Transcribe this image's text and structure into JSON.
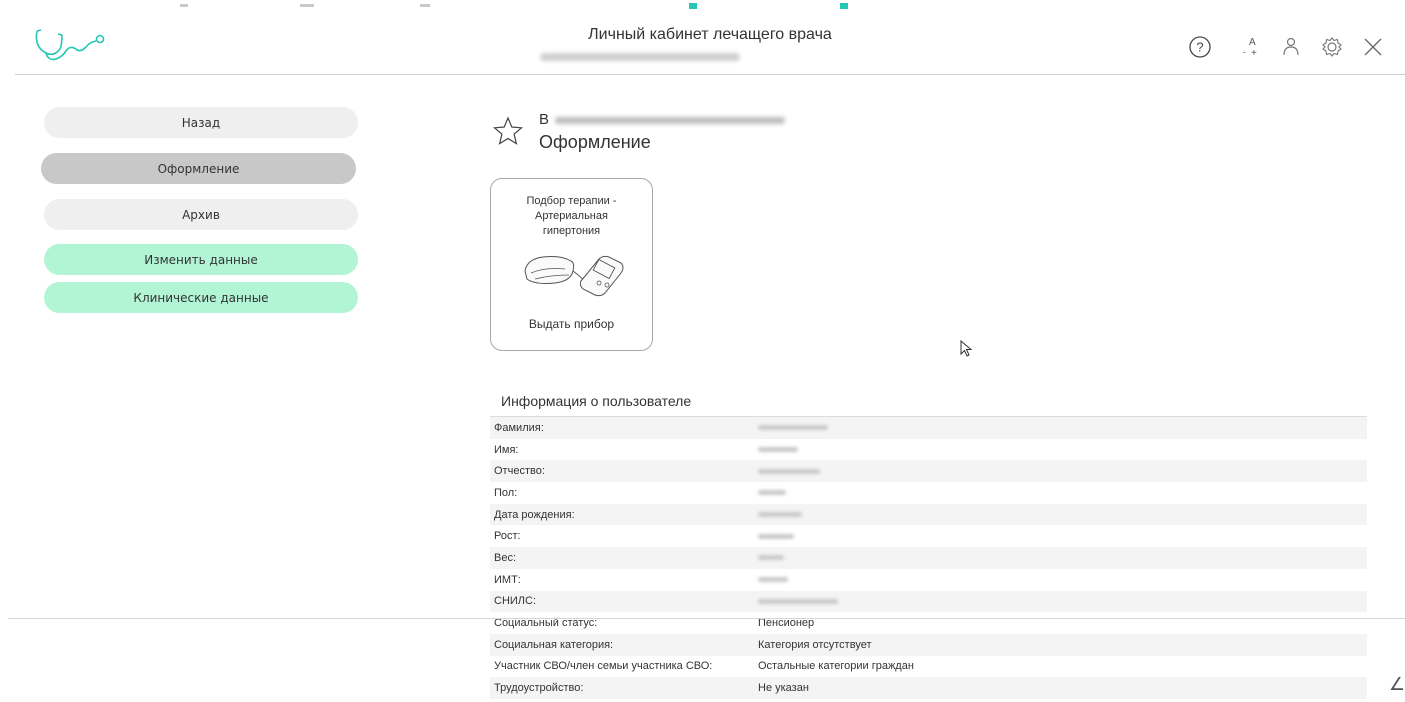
{
  "header": {
    "title": "Личный кабинет лечащего врача",
    "icons": [
      "help-icon",
      "font-size-icon",
      "user-icon",
      "settings-icon",
      "close-icon"
    ],
    "font_size_icon_text": {
      "a": "A",
      "minus": "-",
      "plus": "+"
    },
    "help_symbol": "?"
  },
  "sidebar": {
    "back": "Назад",
    "registration": "Оформление",
    "archive": "Архив",
    "edit_data": "Изменить данные",
    "clinical_data": "Клинические данные"
  },
  "patient": {
    "name_initial": "В",
    "section": "Оформление"
  },
  "card": {
    "title": "Подбор терапии -\nАртериальная\nгипертония",
    "action": "Выдать прибор"
  },
  "info": {
    "title": "Информация о пользователе",
    "rows": [
      {
        "label": "Фамилия:",
        "value": ""
      },
      {
        "label": "Имя:",
        "value": ""
      },
      {
        "label": "Отчество:",
        "value": ""
      },
      {
        "label": "Пол:",
        "value": ""
      },
      {
        "label": "Дата рождения:",
        "value": ""
      },
      {
        "label": "Рост:",
        "value": ""
      },
      {
        "label": "Вес:",
        "value": ""
      },
      {
        "label": "ИМТ:",
        "value": ""
      },
      {
        "label": "СНИЛС:",
        "value": ""
      },
      {
        "label": "Социальный статус:",
        "value": "Пенсионер"
      },
      {
        "label": "Социальная категория:",
        "value": "Категория отсутствует"
      },
      {
        "label": "Участник СВО/член семьи участника СВО:",
        "value": "Остальные категории граждан"
      },
      {
        "label": "Трудоустройство:",
        "value": "Не указан"
      }
    ]
  },
  "corner_mark": "∠",
  "colors": {
    "accent": "#25c7b5",
    "green_button": "#b2f5d4",
    "active_button": "#c8c8c8",
    "grey_button": "#efefef"
  }
}
